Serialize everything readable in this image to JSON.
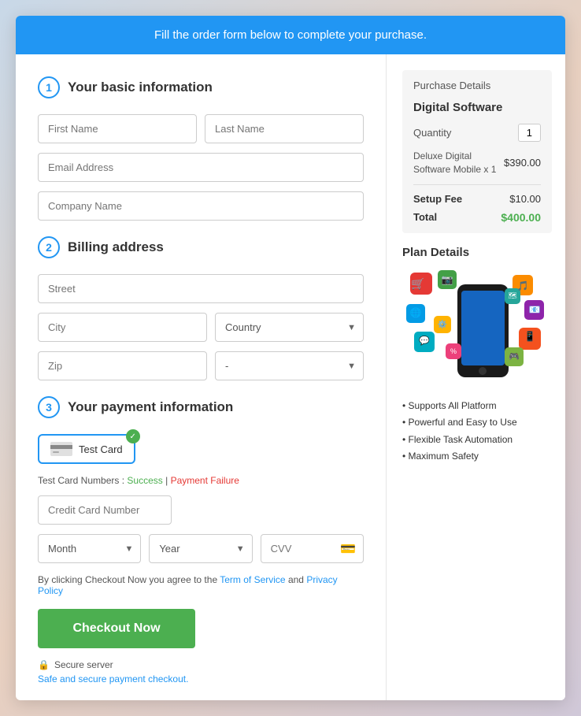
{
  "banner": {
    "text": "Fill the order form below to complete your purchase."
  },
  "left": {
    "section1": {
      "step": "1",
      "title": "Your basic information"
    },
    "fields": {
      "firstName": "First Name",
      "lastName": "Last Name",
      "emailAddress": "Email Address",
      "companyName": "Company Name"
    },
    "section2": {
      "step": "2",
      "title": "Billing address"
    },
    "billing": {
      "street": "Street",
      "city": "City",
      "country": "Country",
      "zip": "Zip",
      "state": "-"
    },
    "section3": {
      "step": "3",
      "title": "Your payment information"
    },
    "payment": {
      "cardLabel": "Test Card",
      "testCardLabel": "Test Card Numbers :",
      "successLink": "Success",
      "separator": "|",
      "failureLink": "Payment Failure",
      "creditCardNumber": "Credit Card Number",
      "month": "Month",
      "year": "Year",
      "cvv": "CVV"
    },
    "terms": {
      "prefix": "By clicking Checkout Now you agree to the",
      "tosLink": "Term of Service",
      "and": "and",
      "ppLink": "Privacy Policy"
    },
    "checkoutBtn": "Checkout Now",
    "secureServer": "Secure server",
    "safeText": "Safe and secure payment checkout."
  },
  "right": {
    "purchaseDetails": {
      "title": "Purchase Details",
      "productTitle": "Digital Software",
      "quantityLabel": "Quantity",
      "quantityValue": "1",
      "productName": "Deluxe Digital Software Mobile x 1",
      "productPrice": "$390.00",
      "setupFeeLabel": "Setup Fee",
      "setupFeeValue": "$10.00",
      "totalLabel": "Total",
      "totalValue": "$400.00"
    },
    "planDetails": {
      "title": "Plan Details",
      "features": [
        "Supports All Platform",
        "Powerful and Easy to Use",
        "Flexible Task Automation",
        "Maximum Safety"
      ]
    }
  }
}
